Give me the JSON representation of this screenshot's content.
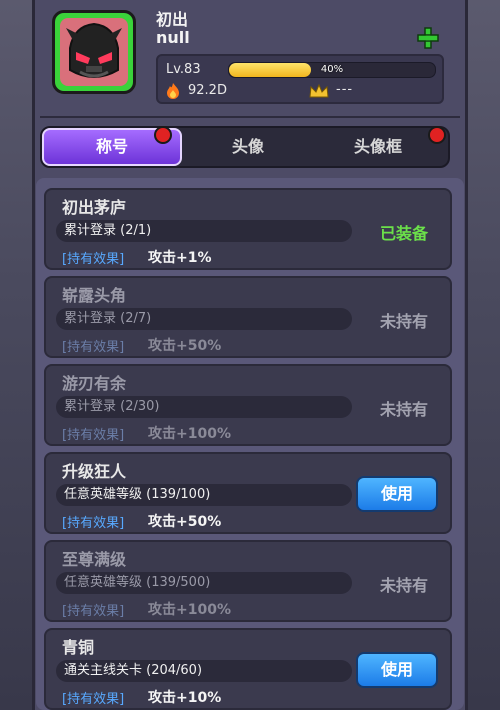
{
  "profile": {
    "name": "初出",
    "subtitle": "null",
    "level": "Lv.83",
    "xp_percent_label": "40%",
    "xp_fraction": 0.4,
    "power": "92.2D",
    "rank": "---"
  },
  "tabs": [
    {
      "label": "称号",
      "active": true,
      "dot": true
    },
    {
      "label": "头像",
      "active": false,
      "dot": false
    },
    {
      "label": "头像框",
      "active": false,
      "dot": true
    }
  ],
  "titles": [
    {
      "name": "初出茅庐",
      "condition": "累计登录 (2/1)",
      "effect_tag": "[持有效果]",
      "effect": "攻击+1%",
      "state": "equipped",
      "state_label": "已装备"
    },
    {
      "name": "崭露头角",
      "condition": "累计登录 (2/7)",
      "effect_tag": "[持有效果]",
      "effect": "攻击+50%",
      "state": "not_owned",
      "state_label": "未持有"
    },
    {
      "name": "游刃有余",
      "condition": "累计登录 (2/30)",
      "effect_tag": "[持有效果]",
      "effect": "攻击+100%",
      "state": "not_owned",
      "state_label": "未持有"
    },
    {
      "name": "升级狂人",
      "condition": "任意英雄等级 (139/100)",
      "effect_tag": "[持有效果]",
      "effect": "攻击+50%",
      "state": "usable",
      "state_label": "使用"
    },
    {
      "name": "至尊满级",
      "condition": "任意英雄等级 (139/500)",
      "effect_tag": "[持有效果]",
      "effect": "攻击+100%",
      "state": "not_owned",
      "state_label": "未持有"
    },
    {
      "name": "青铜",
      "condition": "通关主线关卡 (204/60)",
      "effect_tag": "[持有效果]",
      "effect": "攻击+10%",
      "state": "usable",
      "state_label": "使用"
    }
  ],
  "colors": {
    "panel": "#4d4b66",
    "tab_active": "#8a4ff0",
    "equipped_green": "#6be04a",
    "use_button": "#2b8cf0",
    "effect_blue": "#58a9ff",
    "avatar_bg": "#d9707b",
    "avatar_border": "#3ad33a"
  },
  "icons": [
    "plus-icon",
    "fire-icon",
    "crown-icon",
    "avatar-mask-icon"
  ]
}
